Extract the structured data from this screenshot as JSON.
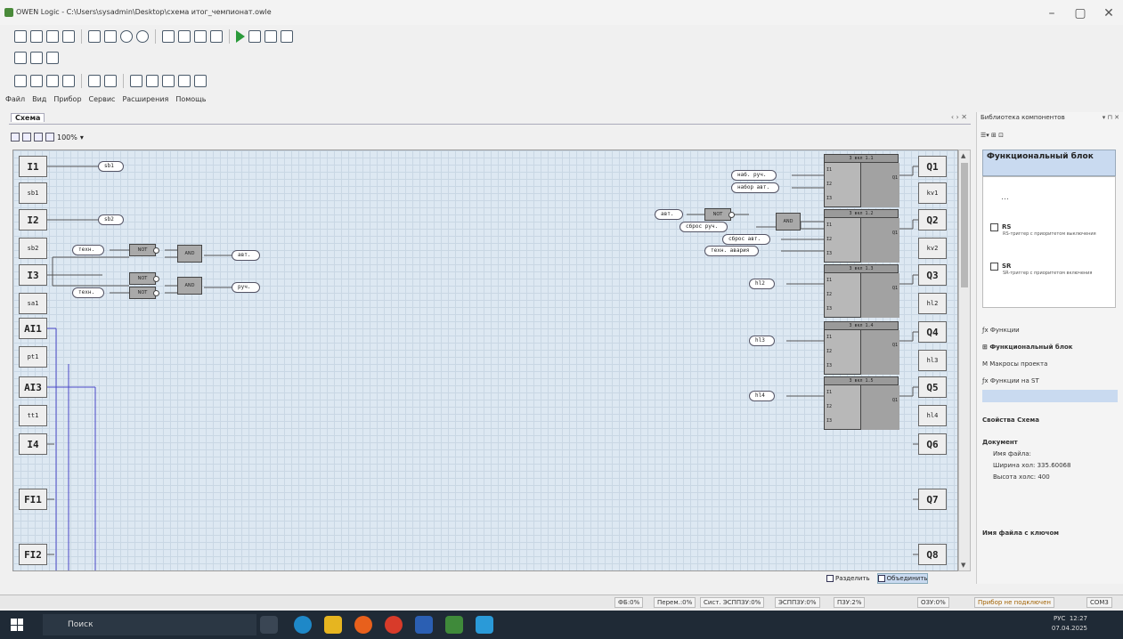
{
  "window": {
    "title": "OWEN Logic - C:\\Users\\sysadmin\\Desktop\\схема итог_чемпионат.owle"
  },
  "menu": [
    "Файл",
    "Вид",
    "Прибор",
    "Сервис",
    "Расширения",
    "Помощь"
  ],
  "tab": {
    "label": "Схема"
  },
  "zoom": {
    "value": "100%"
  },
  "inputs": [
    {
      "id": "in1",
      "label": "I1"
    },
    {
      "id": "sb1",
      "label": "sb1"
    },
    {
      "id": "in2",
      "label": "I2"
    },
    {
      "id": "sb2",
      "label": "sb2"
    },
    {
      "id": "in3",
      "label": "I3"
    },
    {
      "id": "sa1",
      "label": "sa1"
    },
    {
      "id": "ai1",
      "label": "AI1"
    },
    {
      "id": "pt1",
      "label": "pt1"
    },
    {
      "id": "ai3",
      "label": "AI3"
    },
    {
      "id": "tt1",
      "label": "tt1"
    },
    {
      "id": "in4",
      "label": "I4"
    },
    {
      "id": "fi1",
      "label": "FI1"
    },
    {
      "id": "fi2",
      "label": "FI2"
    }
  ],
  "outputs": [
    {
      "id": "q1",
      "label": "Q1"
    },
    {
      "id": "kv1",
      "label": "kv1"
    },
    {
      "id": "q2",
      "label": "Q2"
    },
    {
      "id": "kv2",
      "label": "kv2"
    },
    {
      "id": "q3",
      "label": "Q3"
    },
    {
      "id": "hl2",
      "label": "hl2"
    },
    {
      "id": "q4",
      "label": "Q4"
    },
    {
      "id": "hl3",
      "label": "hl3"
    },
    {
      "id": "q5",
      "label": "Q5"
    },
    {
      "id": "hl4",
      "label": "hl4"
    },
    {
      "id": "q6",
      "label": "Q6"
    },
    {
      "id": "q7",
      "label": "Q7"
    },
    {
      "id": "q8",
      "label": "Q8"
    }
  ],
  "variables": {
    "v_sb1": "sb1",
    "v_sb2": "sb2",
    "v_tech1": "техн.",
    "v_tech2": "техн.",
    "v_avt_out": "авт.",
    "v_ruch_out": "руч.",
    "v_nab_ruch": "наб. руч.",
    "v_nabor_avt": "набор авт.",
    "v_avt_in": "авт.",
    "v_sbros_ruch": "сброс руч.",
    "v_sbros_avt": "сброс авт.",
    "v_tekh_avaria": "техн. авария",
    "v_hl2": "hl2",
    "v_hl3": "hl3",
    "v_hl4": "hl4"
  },
  "gates": {
    "not": "NOT",
    "and": "AND"
  },
  "blocks": [
    {
      "title": "3 вкл 1.1",
      "ins": [
        "I1",
        "I2",
        "I3"
      ],
      "out": "Q1"
    },
    {
      "title": "3 вкл 1.2",
      "ins": [
        "I1",
        "I2",
        "I3"
      ],
      "out": "Q1"
    },
    {
      "title": "3 вкл 1.3",
      "ins": [
        "I1",
        "I2",
        "I3"
      ],
      "out": "Q1"
    },
    {
      "title": "3 вкл 1.4",
      "ins": [
        "I1",
        "I2",
        "I3"
      ],
      "out": "Q1"
    },
    {
      "title": "3 вкл 1.5",
      "ins": [
        "I1",
        "I2",
        "I3"
      ],
      "out": "Q1"
    }
  ],
  "bottom": {
    "split": "Разделить",
    "merge": "Объединить"
  },
  "library": {
    "title": "Библиотека компонентов",
    "group": "Функциональный блок",
    "dots": "…",
    "items": [
      {
        "name": "RS",
        "desc": "RS-триггер с приоритетом выключения"
      },
      {
        "name": "SR",
        "desc": "SR-триггер с приоритетом включения"
      }
    ],
    "categories": [
      "Функции",
      "Функциональный блок",
      "Макросы проекта",
      "Функции на ST"
    ]
  },
  "props": {
    "title": "Свойства Схема",
    "group": "Документ",
    "rows": [
      "Имя файла: ",
      "Ширина хол: 335.60068",
      "Высота холс: 400"
    ],
    "footer": "Имя файла с ключом"
  },
  "status": [
    "ФБ:0%",
    "Перем.:0%",
    "Сист. ЭСППЗУ:0%",
    "ЭСППЗУ:0%",
    "ПЗУ:2%",
    "ОЗУ:0%",
    "Прибор не подключен",
    "COM3"
  ],
  "taskbar": {
    "search": "Поиск",
    "time": "12:27",
    "date": "07.04.2025",
    "lang": "РУС"
  }
}
